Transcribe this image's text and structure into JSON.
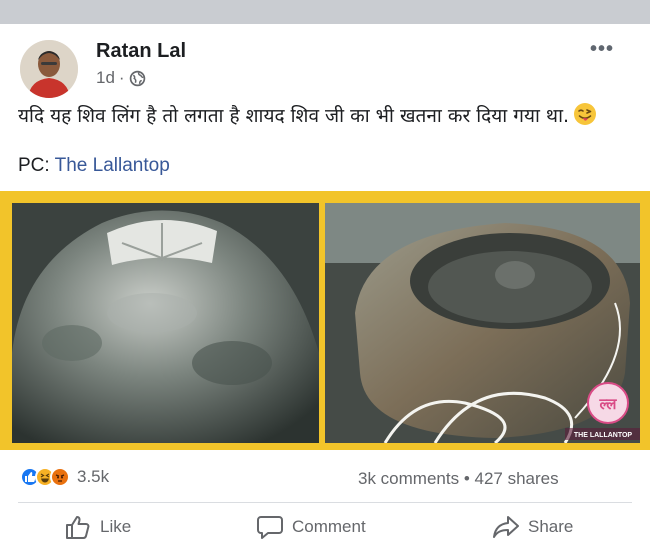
{
  "post": {
    "author": "Ratan Lal",
    "time": "1d",
    "separator": "·",
    "privacy_icon": "globe-icon",
    "more_icon": "more-options-icon",
    "more_label": "•••",
    "text": "यदि यह शिव लिंग है तो लगता है शायद शिव जी का भी खतना कर दिया गया था.",
    "emoji": "winking-face-with-tongue",
    "credit_prefix": "PC:",
    "credit_link": "The Lallantop"
  },
  "image": {
    "frame_color": "#f2c42a",
    "watermark": "THE LALLANTOP"
  },
  "reactions": {
    "icons": [
      "like-reaction-icon",
      "haha-reaction-icon",
      "angry-reaction-icon"
    ],
    "count": "3.5k"
  },
  "stats": {
    "comments": "3k comments",
    "dot": "•",
    "shares": "427 shares"
  },
  "actions": {
    "like": "Like",
    "comment": "Comment",
    "share": "Share"
  },
  "colors": {
    "link": "#385898",
    "like_blue": "#1877f2",
    "secondary_text": "#65676b"
  }
}
